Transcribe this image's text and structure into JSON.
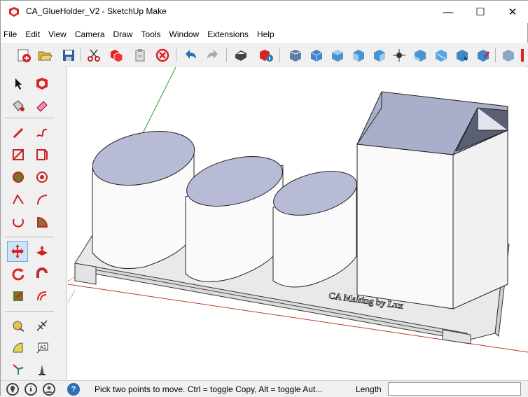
{
  "window": {
    "title": "CA_GlueHolder_V2 - SketchUp Make",
    "minimize_label": "—",
    "maximize_label": "☐",
    "close_label": "✕"
  },
  "menu": [
    {
      "label": "File"
    },
    {
      "label": "Edit"
    },
    {
      "label": "View"
    },
    {
      "label": "Camera"
    },
    {
      "label": "Draw"
    },
    {
      "label": "Tools"
    },
    {
      "label": "Window"
    },
    {
      "label": "Extensions"
    },
    {
      "label": "Help"
    }
  ],
  "toolbar_icons": [
    "new-icon",
    "open-icon",
    "save-icon",
    "cut-icon",
    "copy-icon",
    "paste-icon",
    "erase-icon",
    "undo-icon",
    "redo-icon",
    "print-icon",
    "model-info-icon",
    "zoom-extents-icon",
    "iso-view-icon",
    "top-view-icon",
    "front-view-icon",
    "right-view-icon",
    "back-view-icon",
    "left-view-icon",
    "x-ray-icon",
    "shaded-icon",
    "textured-icon",
    "monochrome-icon",
    "section-plane-icon"
  ],
  "left_tools": [
    "select-icon",
    "make-component-icon",
    "paint-bucket-icon",
    "eraser-icon",
    "line-icon",
    "freehand-icon",
    "rectangle-icon",
    "rotated-rectangle-icon",
    "circle-icon",
    "polygon-icon",
    "arc-icon",
    "two-point-arc-icon",
    "three-point-arc-icon",
    "pie-icon",
    "move-icon",
    "push-pull-icon",
    "rotate-icon",
    "follow-me-icon",
    "scale-icon",
    "offset-icon",
    "tape-measure-icon",
    "dimension-icon",
    "protractor-icon",
    "text-icon",
    "axes-icon",
    "3d-text-icon"
  ],
  "model": {
    "embossed_text": "CA Making by Lux"
  },
  "status": {
    "hint": "Pick two points to move.  Ctrl = toggle Copy, Alt = toggle Aut...",
    "measurement_label": "Length",
    "measurement_value": "",
    "help_icon_label": "?"
  },
  "colors": {
    "toolbar_bg": "#f0f0f0",
    "axis_green": "#2a9d2a",
    "axis_red": "#c0392b",
    "cylinder_inner": "#b8bbd6",
    "box_inner": "#a9aecb",
    "model_face": "#f7f7f7",
    "base_face": "#e9e9e9"
  }
}
